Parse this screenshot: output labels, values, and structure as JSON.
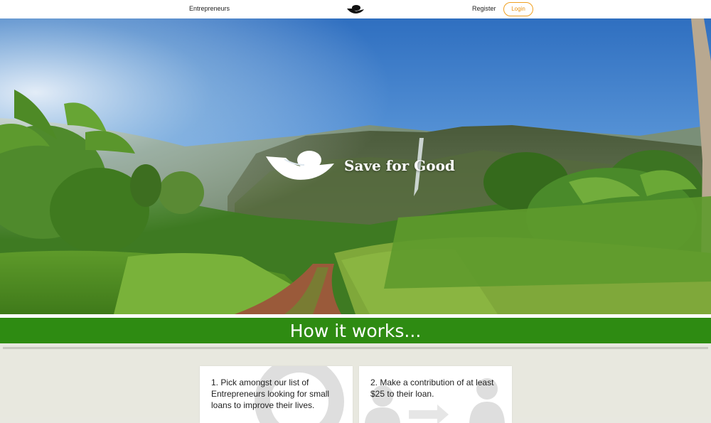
{
  "nav": {
    "entrepreneurs_label": "Entrepreneurs",
    "register_label": "Register",
    "login_label": "Login",
    "logo_icon": "hand-holding-egg-icon"
  },
  "hero": {
    "brand_title": "Save for Good",
    "brand_icon": "hand-holding-egg-icon"
  },
  "how": {
    "title": "How it works...",
    "band_color": "#2e8b12"
  },
  "steps": [
    {
      "text": "1. Pick amongst our list of Entrepreneurs looking for small loans to improve their lives.",
      "icon": "search-icon"
    },
    {
      "text": "2. Make a contribution of at least $25 to their loan.",
      "icon": "people-transfer-icon"
    }
  ],
  "colors": {
    "accent": "#f0a020",
    "brand_green": "#2e8b12"
  }
}
